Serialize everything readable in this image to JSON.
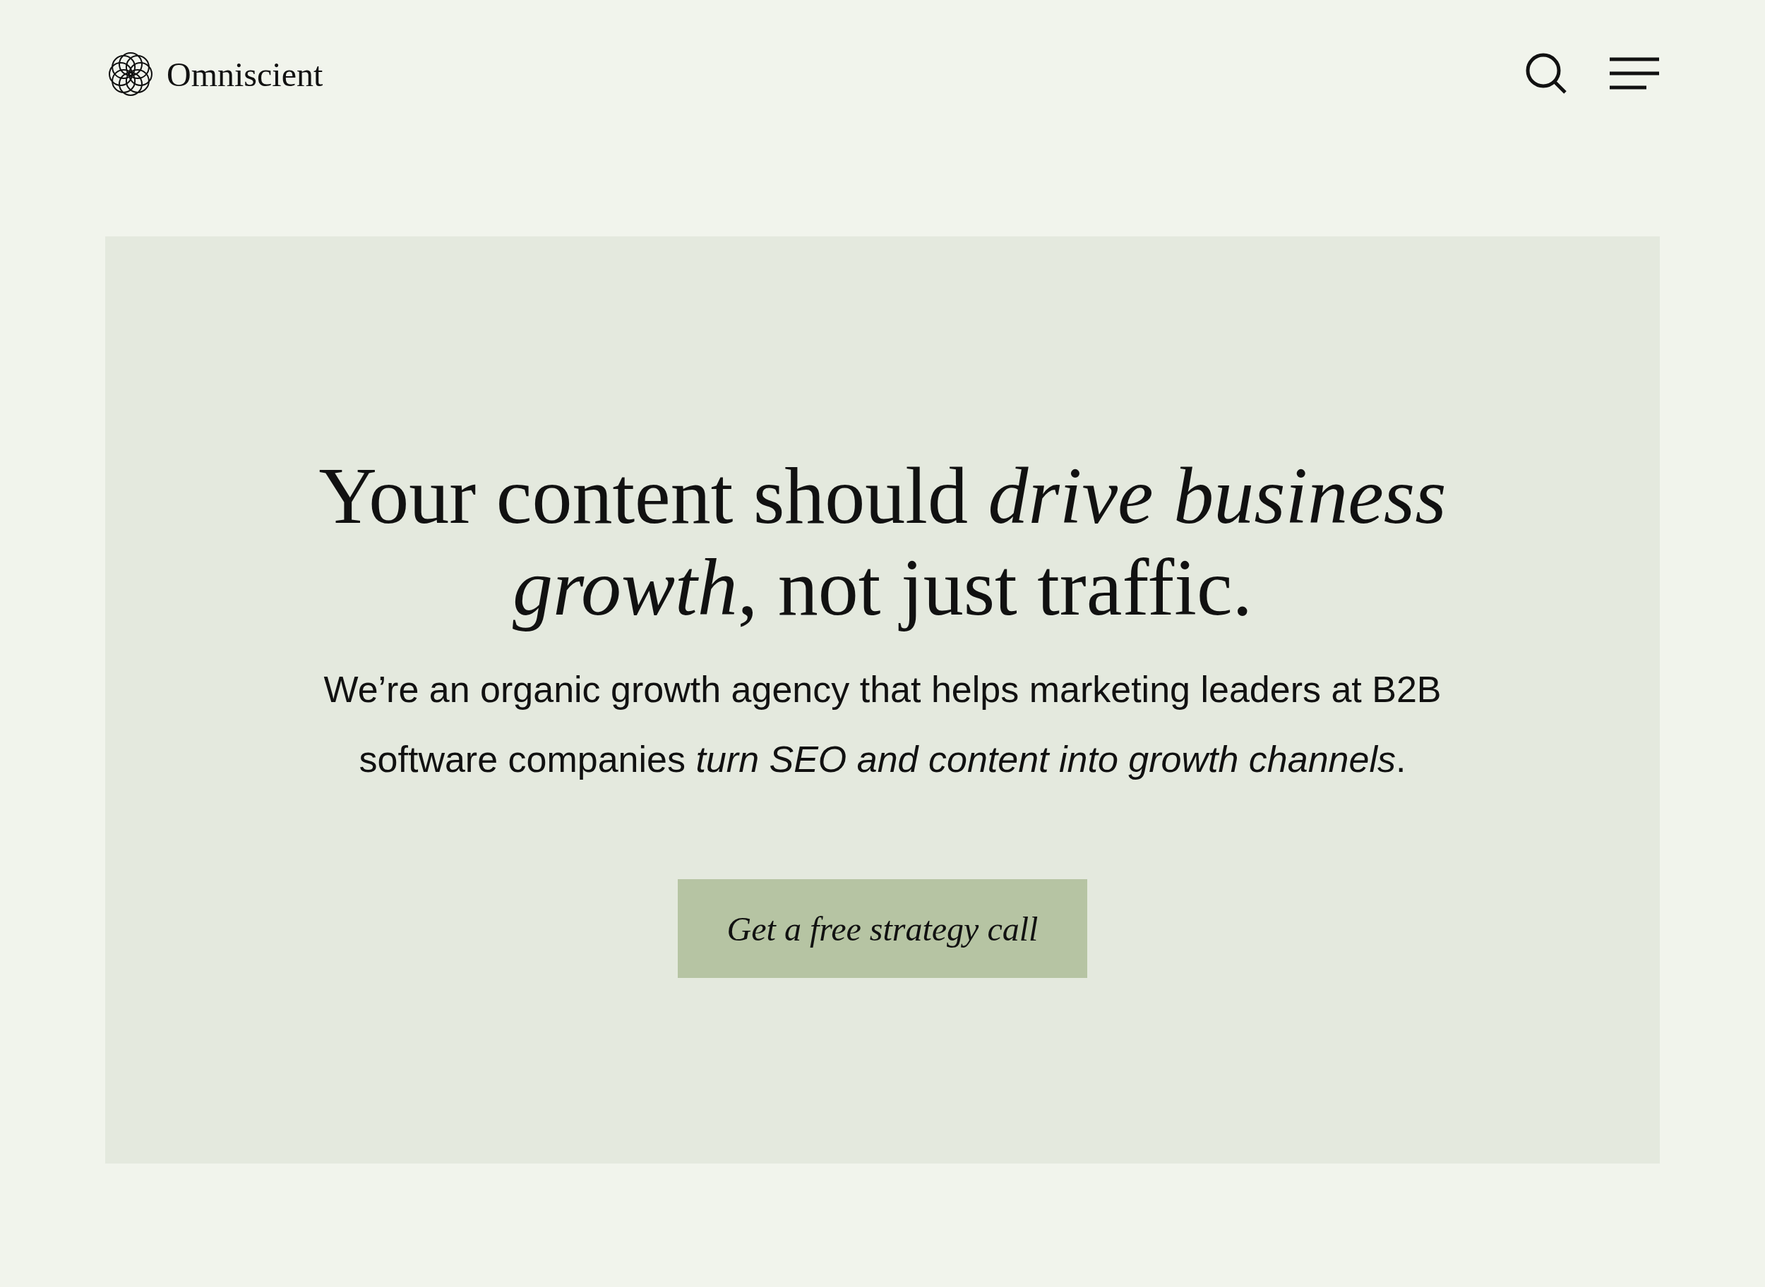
{
  "header": {
    "logo": "Omniscient"
  },
  "hero": {
    "heading": "Your content should *drive business growth*, not just traffic.",
    "text": "We’re an organic growth agency that helps marketing leaders at B2B software companies *turn SEO and content into growth channels*.",
    "button": "Get a free strategy call"
  }
}
